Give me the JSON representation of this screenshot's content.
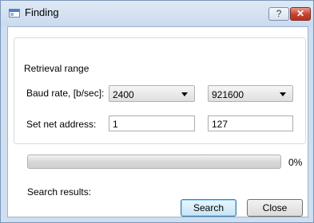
{
  "window": {
    "title": "Finding",
    "help_glyph": "?",
    "close_glyph": "✕"
  },
  "range": {
    "group_title": "Retrieval range",
    "baud_label": "Baud rate, [b/sec]:",
    "baud_from": "2400",
    "baud_to": "921600",
    "addr_label": "Set net address:",
    "addr_from": "1",
    "addr_to": "127"
  },
  "progress": {
    "value_percent": 0,
    "label": "0%"
  },
  "results": {
    "label": "Search results:"
  },
  "buttons": {
    "search": "Search",
    "close": "Close"
  },
  "colors": {
    "accent": "#3c7fb1",
    "progress_fill": "#3cc43c",
    "close_button": "#c7402d"
  }
}
